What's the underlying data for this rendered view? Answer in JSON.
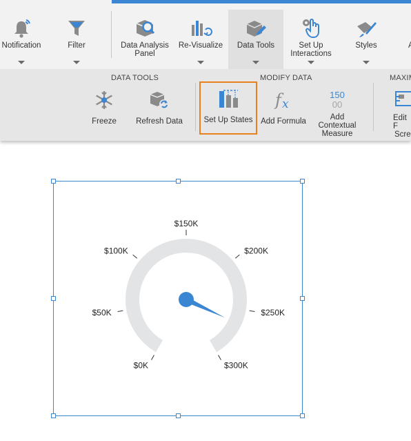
{
  "toolbar": {
    "buttons": [
      {
        "label": "Notification",
        "icon": "bell-icon"
      },
      {
        "label": "Filter",
        "icon": "filter-icon"
      },
      {
        "label": "Data Analysis Panel",
        "icon": "data-analysis-icon"
      },
      {
        "label": "Re-Visualize",
        "icon": "revisualize-icon"
      },
      {
        "label": "Data Tools",
        "icon": "data-tools-icon",
        "active": true
      },
      {
        "label": "Set Up Interactions",
        "icon": "interactions-hand-icon"
      },
      {
        "label": "Styles",
        "icon": "styles-paint-icon"
      },
      {
        "label": "A",
        "icon": "truncated-icon"
      }
    ]
  },
  "ribbon": {
    "groups": {
      "data_tools": "DATA TOOLS",
      "modify_data": "MODIFY DATA",
      "maximize": "MAXIM"
    },
    "buttons": {
      "freeze": "Freeze",
      "refresh_data": "Refresh Data",
      "set_up_states": "Set Up States",
      "add_formula": "Add Formula",
      "add_contextual_measure": "Add Contextual Measure",
      "edit_full_screen_line1": "Edit F",
      "edit_full_screen_line2": "Scre"
    },
    "contextual_icon_top": "150",
    "contextual_icon_bottom": "00",
    "highlight_color": "#e8801e"
  },
  "gauge": {
    "min": 0,
    "max": 300000,
    "value": 265000,
    "ticks": [
      "$0K",
      "$50K",
      "$100K",
      "$150K",
      "$200K",
      "$250K",
      "$300K"
    ],
    "arc_color": "#e3e4e6",
    "needle_color": "#3b86d2",
    "selection_color": "#3b86d2"
  }
}
